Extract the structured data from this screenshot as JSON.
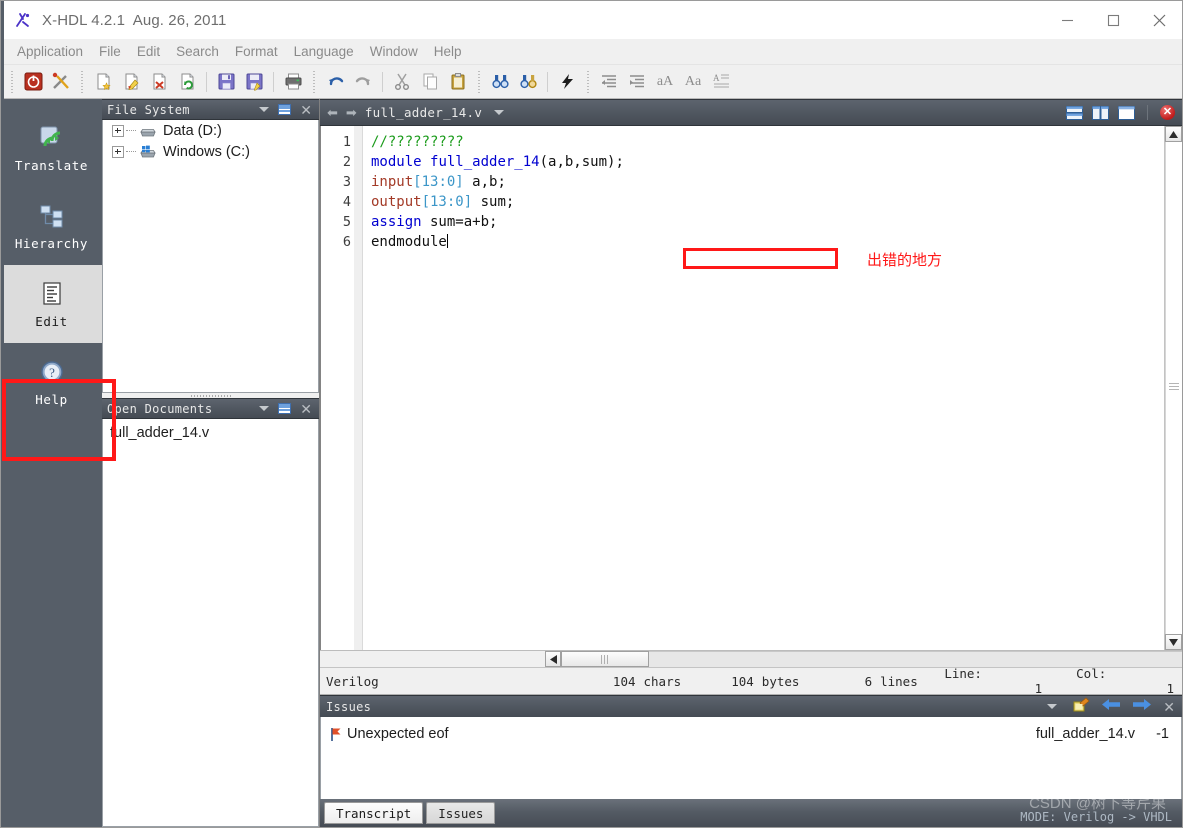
{
  "window": {
    "title": "X-HDL 4.2.1  Aug. 26, 2011",
    "app_icon": "x-hdl-logo-icon",
    "minimize_label": "–",
    "maximize_label": "□",
    "close_label": "✕"
  },
  "menubar": {
    "items": [
      {
        "label": "Application"
      },
      {
        "label": "File"
      },
      {
        "label": "Edit"
      },
      {
        "label": "Search"
      },
      {
        "label": "Format"
      },
      {
        "label": "Language"
      },
      {
        "label": "Window"
      },
      {
        "label": "Help"
      }
    ]
  },
  "toolbar": {
    "buttons": [
      {
        "name": "exit-icon"
      },
      {
        "name": "tools-icon"
      },
      {
        "name": "new-file-icon"
      },
      {
        "name": "edit-file-icon"
      },
      {
        "name": "close-file-icon"
      },
      {
        "name": "refresh-file-icon"
      },
      {
        "name": "save-icon"
      },
      {
        "name": "save-as-icon"
      },
      {
        "name": "print-icon"
      },
      {
        "name": "undo-icon"
      },
      {
        "name": "redo-icon"
      },
      {
        "name": "cut-icon"
      },
      {
        "name": "copy-icon"
      },
      {
        "name": "paste-icon"
      },
      {
        "name": "find-icon"
      },
      {
        "name": "find-replace-icon"
      },
      {
        "name": "lightning-icon"
      },
      {
        "name": "indent-decrease-icon"
      },
      {
        "name": "indent-increase-icon"
      },
      {
        "name": "uppercase-icon",
        "label": "aA"
      },
      {
        "name": "lowercase-icon",
        "label": "Aa"
      },
      {
        "name": "format-text-icon"
      }
    ]
  },
  "rail": {
    "items": [
      {
        "label": "Translate",
        "icon": "translate-icon",
        "active": false
      },
      {
        "label": "Hierarchy",
        "icon": "hierarchy-icon",
        "active": false
      },
      {
        "label": "Edit",
        "icon": "edit-document-icon",
        "active": true
      },
      {
        "label": "Help",
        "icon": "help-question-icon",
        "active": false
      }
    ],
    "highlight_color": "#ff1818"
  },
  "file_system_panel": {
    "title": "File System",
    "tree": [
      {
        "label": "Data (D:)",
        "icon": "hard-drive-icon",
        "expandable": true
      },
      {
        "label": "Windows (C:)",
        "icon": "windows-drive-icon",
        "expandable": true
      }
    ]
  },
  "open_documents_panel": {
    "title": "Open Documents",
    "documents": [
      {
        "label": "full_adder_14.v"
      }
    ]
  },
  "editor": {
    "tab_title": "full_adder_14.v",
    "lines": [
      {
        "num": "1",
        "tokens": [
          {
            "t": "//?????????",
            "c": "cmt"
          }
        ]
      },
      {
        "num": "2",
        "tokens": [
          {
            "t": "module",
            "c": "kw"
          },
          {
            "t": " ",
            "c": ""
          },
          {
            "t": "full_adder_14",
            "c": "kw"
          },
          {
            "t": "(a,b,sum);",
            "c": ""
          }
        ]
      },
      {
        "num": "3",
        "tokens": [
          {
            "t": "input",
            "c": "kw2"
          },
          {
            "t": "[13:0]",
            "c": "num"
          },
          {
            "t": " a,b;",
            "c": ""
          }
        ]
      },
      {
        "num": "4",
        "tokens": [
          {
            "t": "output",
            "c": "kw2"
          },
          {
            "t": "[13:0]",
            "c": "num"
          },
          {
            "t": " sum;",
            "c": ""
          }
        ]
      },
      {
        "num": "5",
        "tokens": [
          {
            "t": "assign",
            "c": "kw"
          },
          {
            "t": " sum=a+b;",
            "c": ""
          }
        ]
      },
      {
        "num": "6",
        "tokens": [
          {
            "t": "endmodule",
            "c": ""
          }
        ]
      }
    ],
    "annotation": {
      "text": "出错的地方",
      "color": "#ff1818"
    }
  },
  "status_bar": {
    "language": "Verilog",
    "chars_value": "104",
    "chars_label": "chars",
    "bytes_value": "104",
    "bytes_label": "bytes",
    "lines_value": "6",
    "lines_label": "lines",
    "line_label": "Line:",
    "line_value": "1",
    "col_label": "Col:",
    "col_value": "1"
  },
  "issues_panel": {
    "title": "Issues",
    "close_label": "✕",
    "rows": [
      {
        "icon": "error-flag-icon",
        "message": "Unexpected eof",
        "file": "full_adder_14.v",
        "line": "-1"
      }
    ]
  },
  "bottom_tabs": {
    "tabs": [
      {
        "label": "Transcript",
        "active": true
      },
      {
        "label": "Issues",
        "active": false
      }
    ],
    "mode_text": "MODE: Verilog -> VHDL",
    "watermark": "CSDN @树下等芹果"
  }
}
